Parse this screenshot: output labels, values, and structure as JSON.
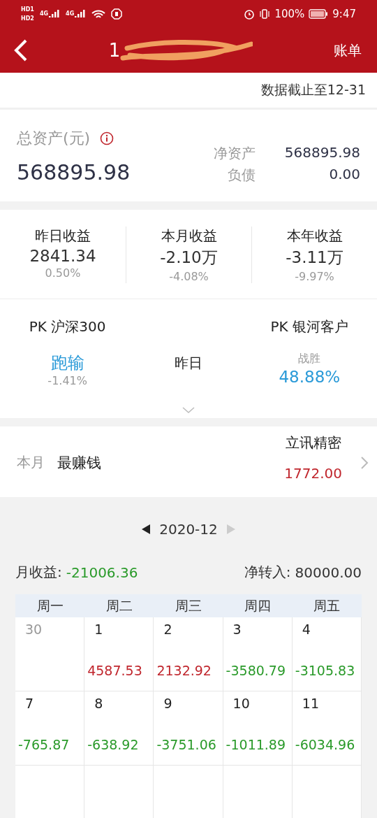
{
  "status_bar": {
    "sims": [
      {
        "label": "HD",
        "slot": "1"
      },
      {
        "label": "HD",
        "slot": "2"
      }
    ],
    "networks": [
      "4G",
      "4G"
    ],
    "battery": "100%",
    "time": "9:47"
  },
  "nav": {
    "title": "1",
    "action": "账单"
  },
  "as_of": "数据截止至12-31",
  "assets": {
    "label": "总资产(元)",
    "total": "568895.98",
    "rows": [
      {
        "label": "净资产",
        "value": "568895.98"
      },
      {
        "label": "负债",
        "value": "0.00"
      }
    ]
  },
  "earnings": [
    {
      "label": "昨日收益",
      "value": "2841.34",
      "percent": "0.50%"
    },
    {
      "label": "本月收益",
      "value": "-2.10万",
      "percent": "-4.08%"
    },
    {
      "label": "本年收益",
      "value": "-3.11万",
      "percent": "-9.97%"
    }
  ],
  "pk": {
    "left": {
      "title": "PK 沪深300",
      "result": "跑输",
      "detail": "-1.41%"
    },
    "middle": "昨日",
    "right": {
      "title": "PK 银河客户",
      "result": "战胜",
      "detail": "48.88%"
    }
  },
  "best": {
    "period": "本月",
    "label": "最赚钱",
    "stock": "立讯精密",
    "amount": "1772.00"
  },
  "calendar": {
    "month": "2020-12",
    "summary": [
      {
        "label": "月收益:",
        "value": "-21006.36",
        "color": "#2a9a2a"
      },
      {
        "label": "净转入:",
        "value": "80000.00",
        "color": "#333333"
      }
    ],
    "weekdays": [
      "周一",
      "周二",
      "周三",
      "周四",
      "周五"
    ],
    "weeks": [
      [
        {
          "day": "30",
          "other_month": true
        },
        {
          "day": "1",
          "amount": "4587.53",
          "color": "#c0262d",
          "other_month": false
        },
        {
          "day": "2",
          "amount": "2132.92",
          "color": "#c0262d",
          "other_month": false
        },
        {
          "day": "3",
          "amount": "-3580.79",
          "color": "#2a9a2a",
          "other_month": false
        },
        {
          "day": "4",
          "amount": "-3105.83",
          "color": "#2a9a2a",
          "other_month": false
        }
      ],
      [
        {
          "day": "7",
          "amount": "-765.87",
          "color": "#2a9a2a",
          "other_month": false
        },
        {
          "day": "8",
          "amount": "-638.92",
          "color": "#2a9a2a",
          "other_month": false
        },
        {
          "day": "9",
          "amount": "-3751.06",
          "color": "#2a9a2a",
          "other_month": false
        },
        {
          "day": "10",
          "amount": "-1011.89",
          "color": "#2a9a2a",
          "other_month": false
        },
        {
          "day": "11",
          "amount": "-6034.96",
          "color": "#2a9a2a",
          "other_month": false
        }
      ]
    ]
  }
}
